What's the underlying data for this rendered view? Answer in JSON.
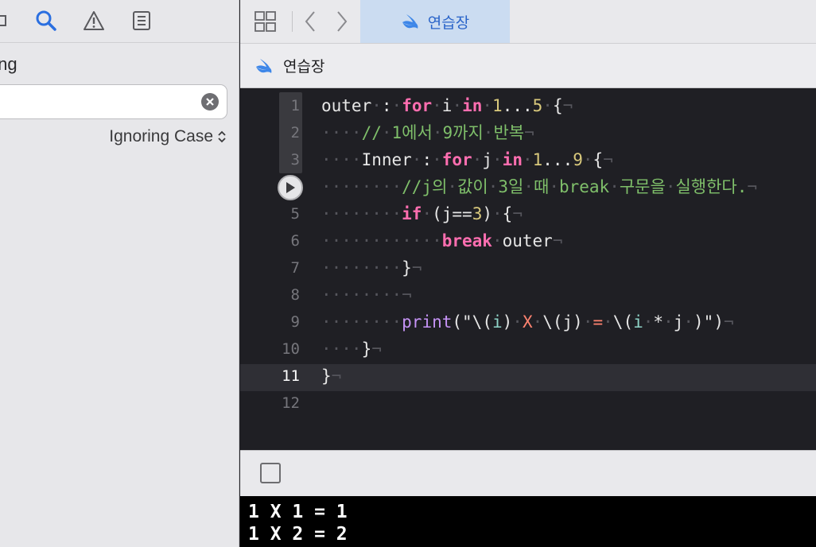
{
  "navigator": {
    "toolbar_icons": [
      "hierarchy-icon",
      "search-icon",
      "warning-icon",
      "list-icon"
    ],
    "heading": "hing",
    "search_value": "",
    "case_option": "Ignoring Case"
  },
  "tabbar": {
    "active_tab": "연습장"
  },
  "jumpbar": {
    "title": "연습장"
  },
  "colors": {
    "keyword": "#ff6eb0",
    "number": "#d9c97c",
    "comment": "#7fbf6a",
    "function": "#c693f6",
    "string": "#ff8370",
    "accent": "#2a64c9"
  },
  "code": {
    "lines": [
      {
        "num": "1",
        "tokens": [
          [
            "",
            "outer"
          ],
          [
            "inv",
            "·"
          ],
          [
            "",
            ":"
          ],
          [
            "inv",
            "·"
          ],
          [
            "kw",
            "for"
          ],
          [
            "inv",
            "·"
          ],
          [
            "",
            "i"
          ],
          [
            "inv",
            "·"
          ],
          [
            "kw",
            "in"
          ],
          [
            "inv",
            "·"
          ],
          [
            "num",
            "1"
          ],
          [
            "",
            "..."
          ],
          [
            "num",
            "5"
          ],
          [
            "inv",
            "·"
          ],
          [
            "",
            "{"
          ],
          [
            "inv",
            "¬"
          ]
        ]
      },
      {
        "num": "2",
        "tokens": [
          [
            "inv",
            "····"
          ],
          [
            "cm",
            "//"
          ],
          [
            "inv",
            "·"
          ],
          [
            "cm",
            "1에서"
          ],
          [
            "inv",
            "·"
          ],
          [
            "cm",
            "9까지"
          ],
          [
            "inv",
            "·"
          ],
          [
            "cm",
            "반복"
          ],
          [
            "inv",
            "¬"
          ]
        ]
      },
      {
        "num": "3",
        "tokens": [
          [
            "inv",
            "····"
          ],
          [
            "",
            "Inner"
          ],
          [
            "inv",
            "·"
          ],
          [
            "",
            ":"
          ],
          [
            "inv",
            "·"
          ],
          [
            "kw",
            "for"
          ],
          [
            "inv",
            "·"
          ],
          [
            "",
            "j"
          ],
          [
            "inv",
            "·"
          ],
          [
            "kw",
            "in"
          ],
          [
            "inv",
            "·"
          ],
          [
            "num",
            "1"
          ],
          [
            "",
            "..."
          ],
          [
            "num",
            "9"
          ],
          [
            "inv",
            "·"
          ],
          [
            "",
            "{"
          ],
          [
            "inv",
            "¬"
          ]
        ]
      },
      {
        "num": "4",
        "tokens": [
          [
            "inv",
            "········"
          ],
          [
            "cm",
            "//j의"
          ],
          [
            "inv",
            "·"
          ],
          [
            "cm",
            "값이"
          ],
          [
            "inv",
            "·"
          ],
          [
            "cm",
            "3일"
          ],
          [
            "inv",
            "·"
          ],
          [
            "cm",
            "때"
          ],
          [
            "inv",
            "·"
          ],
          [
            "cm",
            "break"
          ],
          [
            "inv",
            "·"
          ],
          [
            "cm",
            "구문을"
          ],
          [
            "inv",
            "·"
          ],
          [
            "cm",
            "실행한다."
          ],
          [
            "inv",
            "¬"
          ]
        ]
      },
      {
        "num": "5",
        "tokens": [
          [
            "inv",
            "········"
          ],
          [
            "kw",
            "if"
          ],
          [
            "inv",
            "·"
          ],
          [
            "",
            "(j=="
          ],
          [
            "num",
            "3"
          ],
          [
            "",
            ")"
          ],
          [
            "inv",
            "·"
          ],
          [
            "",
            "{"
          ],
          [
            "inv",
            "¬"
          ]
        ]
      },
      {
        "num": "6",
        "tokens": [
          [
            "inv",
            "············"
          ],
          [
            "kw",
            "break"
          ],
          [
            "inv",
            "·"
          ],
          [
            "",
            "outer"
          ],
          [
            "inv",
            "¬"
          ]
        ]
      },
      {
        "num": "7",
        "tokens": [
          [
            "inv",
            "········"
          ],
          [
            "",
            "}"
          ],
          [
            "inv",
            "¬"
          ]
        ]
      },
      {
        "num": "8",
        "tokens": [
          [
            "inv",
            "········¬"
          ]
        ]
      },
      {
        "num": "9",
        "tokens": [
          [
            "inv",
            "········"
          ],
          [
            "fn",
            "print"
          ],
          [
            "",
            "(\""
          ],
          [
            "",
            "\\("
          ],
          [
            "ip",
            "i"
          ],
          [
            "",
            ")"
          ],
          [
            "inv",
            "·"
          ],
          [
            "str",
            "X"
          ],
          [
            "inv",
            "·"
          ],
          [
            "",
            "\\(j)"
          ],
          [
            "inv",
            "·"
          ],
          [
            "str",
            "="
          ],
          [
            "inv",
            "·"
          ],
          [
            "",
            "\\("
          ],
          [
            "ip",
            "i"
          ],
          [
            "inv",
            "·"
          ],
          [
            "",
            "*"
          ],
          [
            "inv",
            "·"
          ],
          [
            "",
            "j"
          ],
          [
            "inv",
            "·"
          ],
          [
            "",
            ")\")"
          ],
          [
            "inv",
            "¬"
          ]
        ]
      },
      {
        "num": "10",
        "tokens": [
          [
            "inv",
            "····"
          ],
          [
            "",
            "}"
          ],
          [
            "inv",
            "¬"
          ]
        ]
      },
      {
        "num": "11",
        "tokens": [
          [
            "",
            "}"
          ],
          [
            "inv",
            "¬"
          ]
        ]
      },
      {
        "num": "12",
        "tokens": []
      }
    ],
    "current_line": "11",
    "run_marker_line": "4"
  },
  "console": {
    "output": [
      "1 X 1 = 1",
      "1 X 2 = 2"
    ]
  }
}
